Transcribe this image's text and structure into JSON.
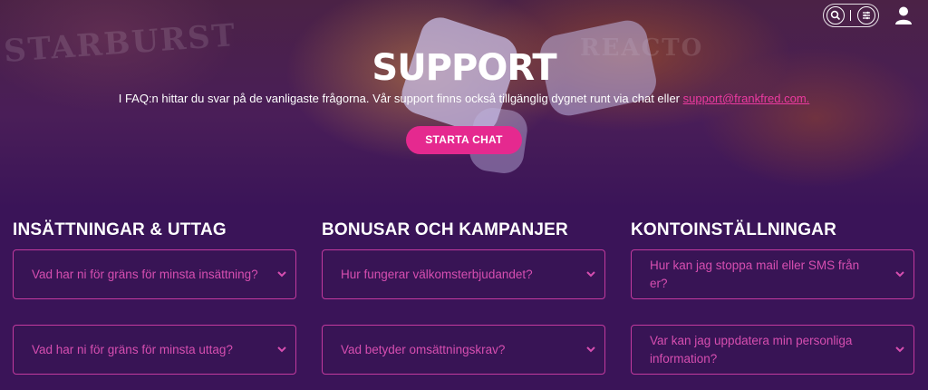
{
  "hero": {
    "title": "SUPPORT",
    "subtitle_text": "I FAQ:n hittar du svar på de vanligaste frågorna. Vår support finns också tillgänglig dygnet runt via chat eller ",
    "support_email": "support@frankfred.com.",
    "cta_label": "STARTA CHAT",
    "background_words": [
      "STARBURST",
      "REACTO"
    ]
  },
  "header": {
    "icons": [
      "search-icon",
      "filter-icon",
      "user-icon"
    ]
  },
  "columns": [
    {
      "title": "INSÄTTNINGAR & UTTAG",
      "items": [
        "Vad har ni för gräns för minsta insättning?",
        "Vad har ni för gräns för minsta uttag?"
      ]
    },
    {
      "title": "BONUSAR OCH KAMPANJER",
      "items": [
        "Hur fungerar välkomsterbjudandet?",
        "Vad betyder omsättningskrav?"
      ]
    },
    {
      "title": "KONTOINSTÄLLNINGAR",
      "items": [
        "Hur kan jag stoppa mail eller SMS från er?",
        "Var kan jag uppdatera min personliga information?"
      ]
    }
  ],
  "colors": {
    "background": "#3a1458",
    "accent": "#e5298f",
    "link": "#ec3aa0",
    "faq_text": "#d64eb0",
    "faq_border": "#c23a9e"
  }
}
